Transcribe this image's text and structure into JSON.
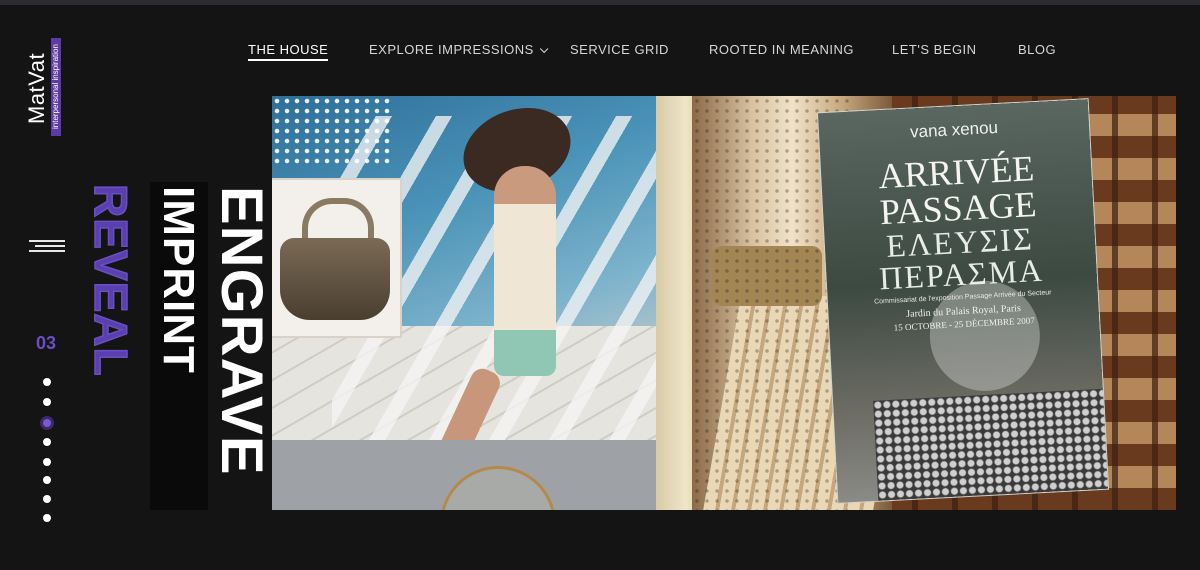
{
  "brand": {
    "name": "MatVat",
    "tagline": "interpersonal inspiration"
  },
  "nav": {
    "items": [
      {
        "label": "THE HOUSE",
        "active": true
      },
      {
        "label": "EXPLORE IMPRESSIONS",
        "has_dropdown": true
      },
      {
        "label": "SERVICE GRID"
      },
      {
        "label": "ROOTED IN MEANING"
      },
      {
        "label": "LET'S BEGIN"
      },
      {
        "label": "BLOG"
      }
    ]
  },
  "slider": {
    "current": "03",
    "total_dots": 8,
    "active_dot": 3
  },
  "hero": {
    "words": {
      "reveal": "REVEAL",
      "imprint": "IMPRINT",
      "engrave": "ENGRAVE"
    }
  },
  "poster": {
    "author": "vana xenou",
    "title_line1": "ARRIVÉE",
    "title_line2": "PASSAGE",
    "greek_line1": "ΕΛΕΥΣΙΣ",
    "greek_line2": "ΠΕΡΑΣΜΑ",
    "subtitle": "Commissariat de l'exposition Passage Arrivée du Secteur",
    "place": "Jardin du Palais Royal, Paris",
    "dates": "15 OCTOBRE - 25 DÉCEMBRE 2007"
  },
  "colors": {
    "background": "#141414",
    "accent": "#6b4fc0",
    "text": "#ffffff"
  }
}
